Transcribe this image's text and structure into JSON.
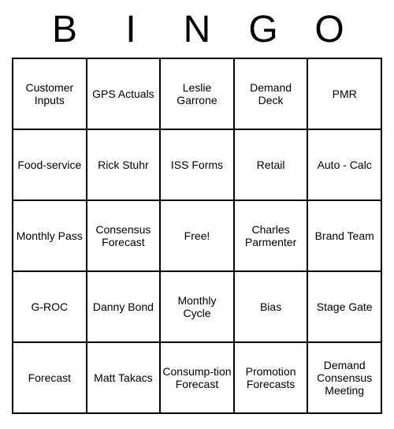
{
  "header": [
    "B",
    "I",
    "N",
    "G",
    "O"
  ],
  "cells": {
    "r0c0": "Customer Inputs",
    "r0c1": "GPS Actuals",
    "r0c2": "Leslie Garrone",
    "r0c3": "Demand Deck",
    "r0c4": "PMR",
    "r1c0": "Food-service",
    "r1c1": "Rick Stuhr",
    "r1c2": "ISS Forms",
    "r1c3": "Retail",
    "r1c4": "Auto - Calc",
    "r2c0": "Monthly Pass",
    "r2c1": "Consensus Forecast",
    "r2c2": "Free!",
    "r2c3": "Charles Parmenter",
    "r2c4": "Brand Team",
    "r3c0": "G-ROC",
    "r3c1": "Danny Bond",
    "r3c2": "Monthly Cycle",
    "r3c3": "Bias",
    "r3c4": "Stage Gate",
    "r4c0": "Forecast",
    "r4c1": "Matt Takacs",
    "r4c2": "Consump-tion Forecast",
    "r4c3": "Promotion Forecasts",
    "r4c4": "Demand Consensus Meeting"
  }
}
